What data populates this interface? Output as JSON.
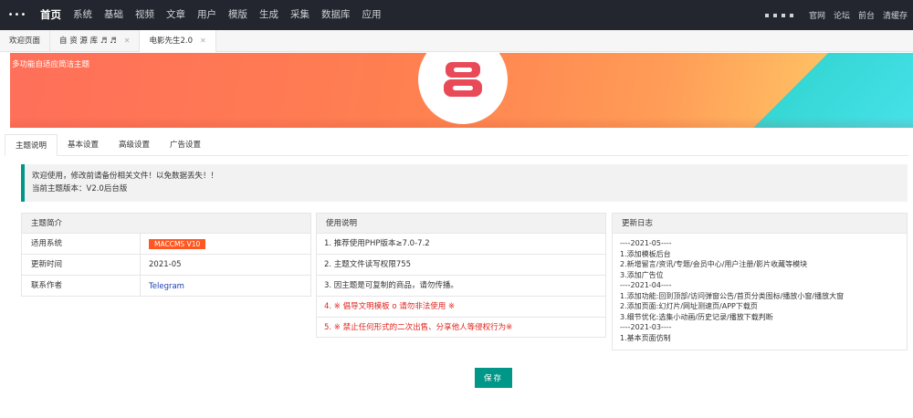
{
  "topnav": {
    "menu_glyph": "•••",
    "items": [
      "首页",
      "系统",
      "基础",
      "视频",
      "文章",
      "用户",
      "模版",
      "生成",
      "采集",
      "数据库",
      "应用"
    ],
    "right_links": [
      "官网",
      "论坛",
      "前台",
      "清缓存"
    ]
  },
  "tabs": [
    {
      "label": "欢迎页面",
      "closable": false
    },
    {
      "label": "自 资 源 库 ♬ ♬",
      "closable": true
    },
    {
      "label": "电影先生2.0",
      "closable": true
    }
  ],
  "tab_close_glyph": "✕",
  "banner": {
    "text": "多功能自适应简洁主题",
    "colors": {
      "start": "#ff6f5a",
      "end": "#ffd66b",
      "logo": "#e94a57",
      "accent": "#35d7d4"
    }
  },
  "settings_tabs": [
    "主题说明",
    "基本设置",
    "高级设置",
    "广告设置"
  ],
  "notice": {
    "line1": "欢迎使用，修改前请备份相关文件！以免数据丢失！！",
    "line2": "当前主题版本：V2.0后台版"
  },
  "intro": {
    "title": "主题简介",
    "rows": [
      {
        "key": "适用系统",
        "value": "MACCMS V10"
      },
      {
        "key": "更新时间",
        "value": "2021-05"
      },
      {
        "key": "联系作者",
        "value": "Telegram"
      }
    ]
  },
  "usage": {
    "title": "使用说明",
    "items": [
      "1. 推荐使用PHP版本≥7.0-7.2",
      "2. 主题文件读写权限755",
      "3. 因主题是可复制的商品，请勿传播。",
      "4. ※ 倡导文明模板 o 请勿非法使用 ※",
      "5. ※ 禁止任何形式的二次出售、分享他人等侵权行为※"
    ]
  },
  "changelog": {
    "title": "更新日志",
    "lines": [
      "----2021-05----",
      "1.添加模板后台",
      "2.新增留言/资讯/专题/会员中心/用户注册/影片收藏等模块",
      "3.添加广告位",
      "----2021-04----",
      "1.添加功能:回到顶部/访问弹窗公告/首页分类图标/播放小窗/播放大窗",
      "2.添加页面:幻灯片/网址测速页/APP下载页",
      "3.细节优化:选集小动画/历史记录/播放下载判断",
      "----2021-03----",
      "1.基本页面仿制"
    ]
  },
  "save_label": "保存",
  "accent_color": "#009688",
  "warning_color": "#e0231e"
}
